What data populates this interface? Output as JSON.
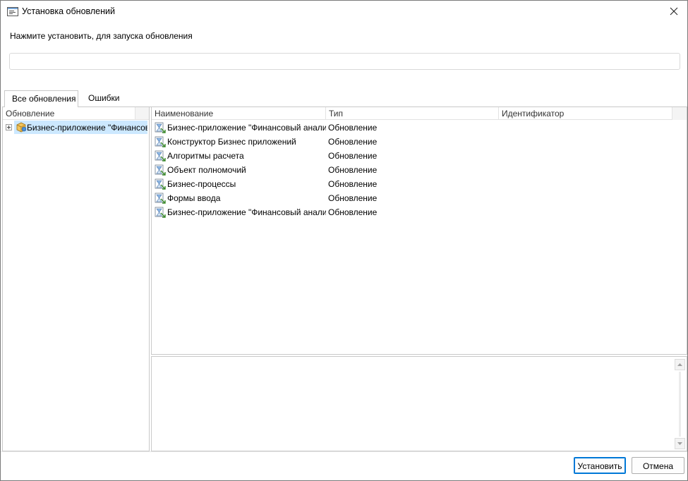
{
  "window": {
    "title": "Установка обновлений",
    "close_icon": "close-icon",
    "app_icon": "window-icon"
  },
  "instruction": "Нажмите установить, для запуска обновления",
  "tabs": [
    {
      "label": "Все обновления",
      "active": true
    },
    {
      "label": "Ошибки",
      "active": false
    }
  ],
  "tree": {
    "header": "Обновление",
    "items": [
      {
        "label": "Бизнес-приложение \"Финансовый анализ компании\"",
        "expanded": false,
        "selected": true,
        "icon": "package-icon"
      }
    ]
  },
  "list": {
    "columns": [
      "Наименование",
      "Тип",
      "Идентификатор"
    ],
    "rows": [
      {
        "name": "Бизнес-приложение \"Финансовый анализ компании\"",
        "type": "Обновление",
        "id": "",
        "icon": "update-item-icon"
      },
      {
        "name": "Конструктор Бизнес приложений",
        "type": "Обновление",
        "id": "",
        "icon": "update-item-icon"
      },
      {
        "name": "Алгоритмы расчета",
        "type": "Обновление",
        "id": "",
        "icon": "update-item-icon"
      },
      {
        "name": "Объект полномочий",
        "type": "Обновление",
        "id": "",
        "icon": "update-item-icon"
      },
      {
        "name": "Бизнес-процессы",
        "type": "Обновление",
        "id": "",
        "icon": "update-item-icon"
      },
      {
        "name": "Формы ввода",
        "type": "Обновление",
        "id": "",
        "icon": "update-item-icon"
      },
      {
        "name": "Бизнес-приложение \"Финансовый анализ компании\"",
        "type": "Обновление",
        "id": "",
        "icon": "update-item-icon"
      }
    ]
  },
  "buttons": {
    "install": "Установить",
    "cancel": "Отмена"
  },
  "colors": {
    "selection": "#cce8ff",
    "default_button_border": "#0078d7",
    "border": "#c9c9c9"
  }
}
